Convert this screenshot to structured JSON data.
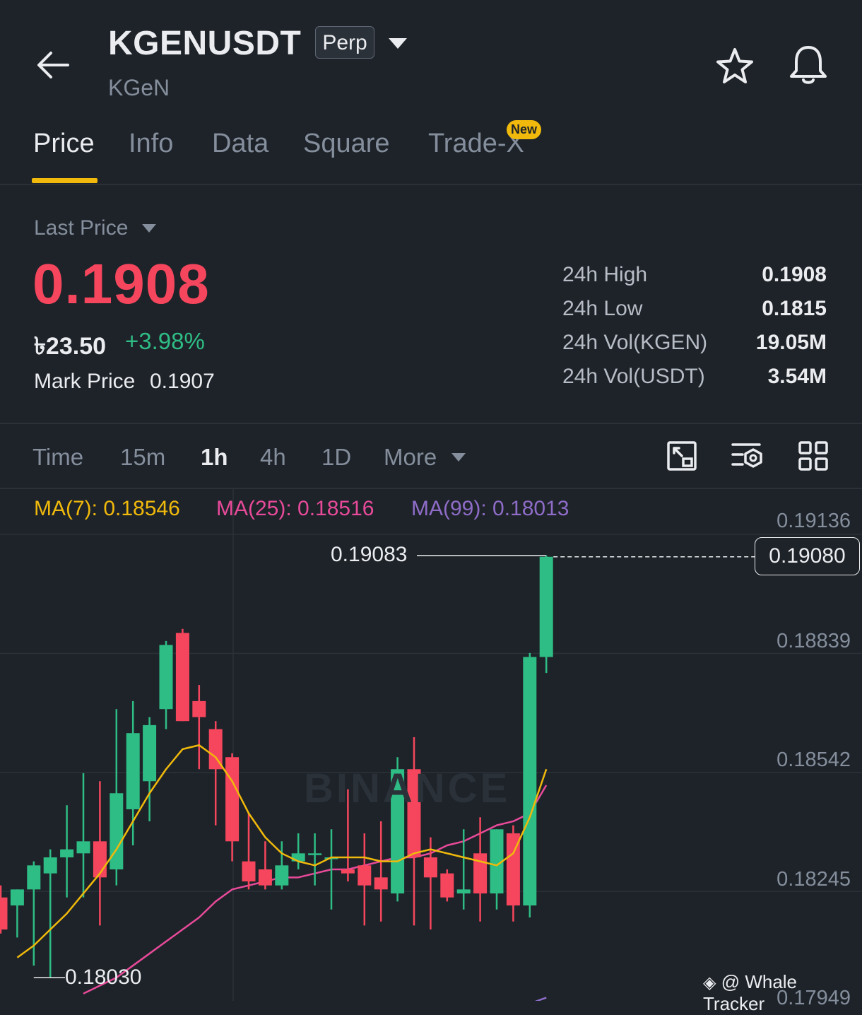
{
  "header": {
    "symbol": "KGENUSDT",
    "contract_type": "Perp",
    "subtitle": "KGeN",
    "icons": [
      "back-arrow-icon",
      "caret-down-icon",
      "star-icon",
      "bell-icon"
    ]
  },
  "tabs": [
    {
      "label": "Price",
      "active": true
    },
    {
      "label": "Info"
    },
    {
      "label": "Data"
    },
    {
      "label": "Square"
    },
    {
      "label": "Trade-X",
      "badge": "New"
    }
  ],
  "price": {
    "mode_label": "Last Price",
    "last": "0.1908",
    "fiat": "৳23.50",
    "change_pct": "+3.98%",
    "mark_label": "Mark Price",
    "mark_value": "0.1907",
    "colors": {
      "down": "#f6465d",
      "up": "#2ebd85"
    }
  },
  "stats": [
    {
      "label": "24h High",
      "value": "0.1908"
    },
    {
      "label": "24h Low",
      "value": "0.1815"
    },
    {
      "label": "24h Vol(KGEN)",
      "value": "19.05M"
    },
    {
      "label": "24h Vol(USDT)",
      "value": "3.54M"
    }
  ],
  "intervals": {
    "items": [
      {
        "label": "Time"
      },
      {
        "label": "15m"
      },
      {
        "label": "1h",
        "active": true
      },
      {
        "label": "4h"
      },
      {
        "label": "1D"
      },
      {
        "label": "More"
      }
    ],
    "tools": [
      "chart-expand-icon",
      "indicator-settings-icon",
      "grid-layout-icon"
    ]
  },
  "ma_legend": [
    {
      "label": "MA(7): 0.18546",
      "color": "#f0b90b"
    },
    {
      "label": "MA(25): 0.18516",
      "color": "#e84a9a"
    },
    {
      "label": "MA(99): 0.18013",
      "color": "#8e6cc8"
    }
  ],
  "chart_data": {
    "type": "candlestick",
    "interval": "1h",
    "y_axis_ticks": [
      "0.19136",
      "0.18839",
      "0.18542",
      "0.18245",
      "0.17949"
    ],
    "ylim": [
      0.1793,
      0.192
    ],
    "current_price": "0.19080",
    "high_marker": "0.19083",
    "low_marker": "0.18030",
    "watermark": "BINANCE",
    "candles": [
      {
        "o": 0.1823,
        "h": 0.1826,
        "l": 0.1814,
        "c": 0.1815
      },
      {
        "o": 0.1821,
        "h": 0.1825,
        "l": 0.1813,
        "c": 0.1825
      },
      {
        "o": 0.1825,
        "h": 0.1832,
        "l": 0.1806,
        "c": 0.1831
      },
      {
        "o": 0.1829,
        "h": 0.1835,
        "l": 0.1803,
        "c": 0.1833
      },
      {
        "o": 0.1833,
        "h": 0.1846,
        "l": 0.1823,
        "c": 0.1835
      },
      {
        "o": 0.1834,
        "h": 0.1854,
        "l": 0.1823,
        "c": 0.1837
      },
      {
        "o": 0.1837,
        "h": 0.1852,
        "l": 0.1816,
        "c": 0.1828
      },
      {
        "o": 0.183,
        "h": 0.187,
        "l": 0.1826,
        "c": 0.1849
      },
      {
        "o": 0.1845,
        "h": 0.1872,
        "l": 0.1836,
        "c": 0.1864
      },
      {
        "o": 0.1852,
        "h": 0.1868,
        "l": 0.1842,
        "c": 0.1866
      },
      {
        "o": 0.187,
        "h": 0.1887,
        "l": 0.1865,
        "c": 0.1886
      },
      {
        "o": 0.1889,
        "h": 0.189,
        "l": 0.1867,
        "c": 0.1867
      },
      {
        "o": 0.1872,
        "h": 0.1876,
        "l": 0.1855,
        "c": 0.1868
      },
      {
        "o": 0.1865,
        "h": 0.1867,
        "l": 0.1841,
        "c": 0.1855
      },
      {
        "o": 0.1858,
        "h": 0.1859,
        "l": 0.1832,
        "c": 0.1837
      },
      {
        "o": 0.1832,
        "h": 0.1844,
        "l": 0.1825,
        "c": 0.1827
      },
      {
        "o": 0.183,
        "h": 0.1837,
        "l": 0.1825,
        "c": 0.1826
      },
      {
        "o": 0.1826,
        "h": 0.1837,
        "l": 0.1825,
        "c": 0.1831
      },
      {
        "o": 0.1832,
        "h": 0.1839,
        "l": 0.183,
        "c": 0.1834
      },
      {
        "o": 0.1834,
        "h": 0.1839,
        "l": 0.1826,
        "c": 0.1834
      },
      {
        "o": 0.1833,
        "h": 0.184,
        "l": 0.182,
        "c": 0.1833
      },
      {
        "o": 0.183,
        "h": 0.185,
        "l": 0.1827,
        "c": 0.1829
      },
      {
        "o": 0.1831,
        "h": 0.1839,
        "l": 0.1816,
        "c": 0.1826
      },
      {
        "o": 0.1828,
        "h": 0.1842,
        "l": 0.1817,
        "c": 0.1825
      },
      {
        "o": 0.1824,
        "h": 0.1858,
        "l": 0.1822,
        "c": 0.1855
      },
      {
        "o": 0.1855,
        "h": 0.1863,
        "l": 0.1816,
        "c": 0.1833
      },
      {
        "o": 0.1833,
        "h": 0.1838,
        "l": 0.1815,
        "c": 0.1828
      },
      {
        "o": 0.1829,
        "h": 0.183,
        "l": 0.1822,
        "c": 0.1823
      },
      {
        "o": 0.1824,
        "h": 0.184,
        "l": 0.182,
        "c": 0.1825
      },
      {
        "o": 0.1834,
        "h": 0.1843,
        "l": 0.1817,
        "c": 0.1824
      },
      {
        "o": 0.1824,
        "h": 0.184,
        "l": 0.182,
        "c": 0.184
      },
      {
        "o": 0.1839,
        "h": 0.1841,
        "l": 0.1817,
        "c": 0.1821
      },
      {
        "o": 0.1821,
        "h": 0.1884,
        "l": 0.1818,
        "c": 0.1883
      },
      {
        "o": 0.1883,
        "h": 0.19083,
        "l": 0.1879,
        "c": 0.1908
      }
    ],
    "ma7": [
      0.1808,
      0.1811,
      0.1815,
      0.1819,
      0.1824,
      0.1829,
      0.1835,
      0.1842,
      0.1849,
      0.1855,
      0.186,
      0.1861,
      0.1858,
      0.1852,
      0.1844,
      0.1838,
      0.1834,
      0.1832,
      0.1831,
      0.1833,
      0.1833,
      0.1833,
      0.1832,
      0.1832,
      0.1834,
      0.1835,
      0.1834,
      0.1833,
      0.1832,
      0.1831,
      0.1834,
      0.1843,
      0.1855
    ],
    "ma25": [
      0.1799,
      0.1801,
      0.1803,
      0.1806,
      0.1809,
      0.1812,
      0.1815,
      0.1818,
      0.1822,
      0.1825,
      0.1826,
      0.1827,
      0.1828,
      0.1828,
      0.1829,
      0.183,
      0.183,
      0.1831,
      0.1832,
      0.1833,
      0.1833,
      0.1834,
      0.1836,
      0.1837,
      0.1839,
      0.1841,
      0.1842,
      0.1844,
      0.1851
    ],
    "ma99": [
      0.1794,
      0.17953,
      0.17965,
      0.1798
    ]
  },
  "credit": "@ Whale Tracker"
}
